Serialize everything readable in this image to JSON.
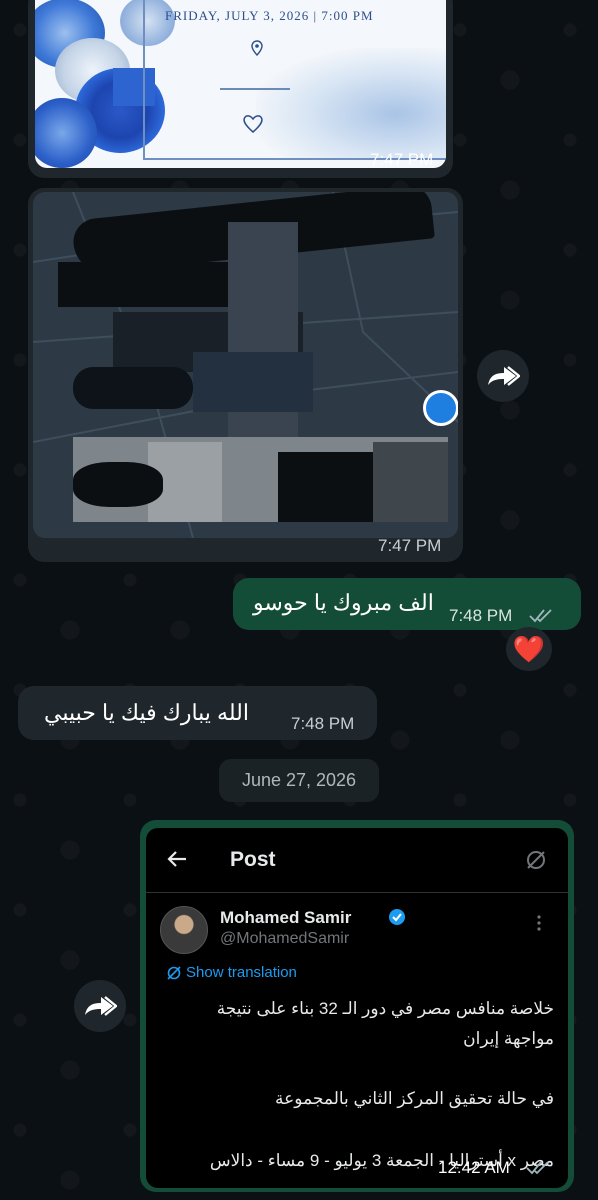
{
  "invitation": {
    "card_date": "FRIDAY, JULY 3, 2026 | 7:00 PM",
    "time": "7:47 PM"
  },
  "map_message": {
    "time": "7:47 PM"
  },
  "outgoing_message": {
    "text": "الف مبروك يا حوسو",
    "time": "7:48 PM",
    "reaction": "❤️"
  },
  "incoming_message": {
    "text": "الله يبارك فيك يا حبيبي",
    "time": "7:48 PM"
  },
  "date_separator": "June 27, 2026",
  "post_screenshot": {
    "header_title": "Post",
    "author_name": "Mohamed Samir",
    "author_handle": "@MohamedSamir",
    "show_translation": "Show translation",
    "line1": "خلاصة منافس مصر في دور الـ 32 بناء على نتيجة",
    "line2": "مواجهة إيران",
    "line3": "في حالة تحقيق المركز الثاني بالمجموعة",
    "line4": "مصر x أستراليا - الجمعة 3 يوليو - 9 مساء - دالاس",
    "time": "12:42 AM"
  },
  "colors": {
    "incoming_bubble": "#1f272c",
    "outgoing_bubble": "#144d37",
    "read_ticks": "#8aa5ad",
    "link_blue": "#1d9bf0",
    "verified_blue": "#1d9bf0"
  },
  "icons": [
    "forward-icon",
    "read-ticks-icon",
    "back-arrow-icon",
    "translate-icon",
    "verified-badge-icon",
    "more-options-icon",
    "location-pin-icon",
    "heart-icon"
  ]
}
